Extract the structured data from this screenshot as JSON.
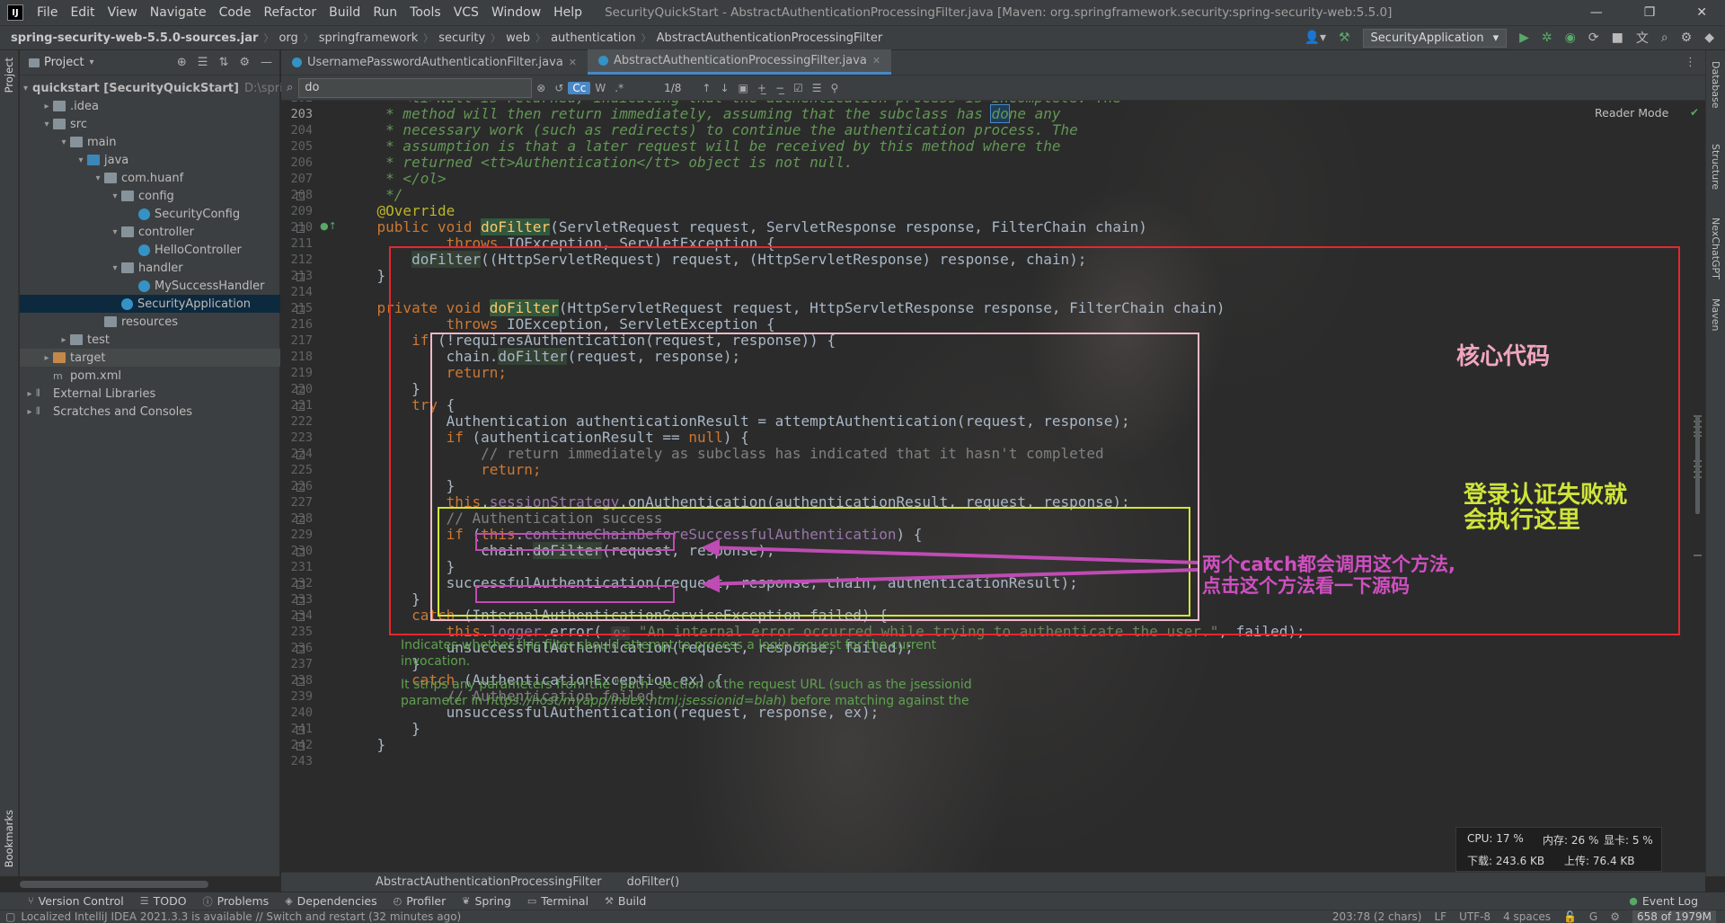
{
  "menubar": {
    "logo": "IJ",
    "items": [
      "File",
      "Edit",
      "View",
      "Navigate",
      "Code",
      "Refactor",
      "Build",
      "Run",
      "Tools",
      "VCS",
      "Window",
      "Help"
    ],
    "window_title": "SecurityQuickStart - AbstractAuthenticationProcessingFilter.java [Maven: org.springframework.security:spring-security-web:5.5.0]",
    "controls": [
      "—",
      "❐",
      "✕"
    ]
  },
  "navbar": {
    "crumbs": [
      "spring-security-web-5.5.0-sources.jar",
      "org",
      "springframework",
      "security",
      "web",
      "authentication",
      "AbstractAuthenticationProcessingFilter"
    ],
    "run_config": "SecurityApplication"
  },
  "left_stripe": {
    "project": "Project",
    "bookmarks": "Bookmarks"
  },
  "right_stripe": [
    "Database",
    "Structure",
    "NexChatGPT",
    "Maven"
  ],
  "project_panel": {
    "title": "Project",
    "tree": [
      {
        "label": "quickstart [SecurityQuickStart]",
        "extra": "D:\\spring",
        "depth": 0,
        "arrow": "▾",
        "icon": "folder"
      },
      {
        "label": ".idea",
        "depth": 1,
        "arrow": "▸",
        "icon": "folder"
      },
      {
        "label": "src",
        "depth": 1,
        "arrow": "▾",
        "icon": "folder"
      },
      {
        "label": "main",
        "depth": 2,
        "arrow": "▾",
        "icon": "folder"
      },
      {
        "label": "java",
        "depth": 3,
        "arrow": "▾",
        "icon": "folder-blue"
      },
      {
        "label": "com.huanf",
        "depth": 4,
        "arrow": "▾",
        "icon": "folder"
      },
      {
        "label": "config",
        "depth": 5,
        "arrow": "▾",
        "icon": "folder"
      },
      {
        "label": "SecurityConfig",
        "depth": 6,
        "arrow": "",
        "icon": "cls"
      },
      {
        "label": "controller",
        "depth": 5,
        "arrow": "▾",
        "icon": "folder"
      },
      {
        "label": "HelloController",
        "depth": 6,
        "arrow": "",
        "icon": "cls"
      },
      {
        "label": "handler",
        "depth": 5,
        "arrow": "▾",
        "icon": "folder"
      },
      {
        "label": "MySuccessHandler",
        "depth": 6,
        "arrow": "",
        "icon": "cls"
      },
      {
        "label": "SecurityApplication",
        "depth": 5,
        "arrow": "",
        "icon": "cls",
        "selected": true
      },
      {
        "label": "resources",
        "depth": 4,
        "arrow": "",
        "icon": "folder"
      },
      {
        "label": "test",
        "depth": 2,
        "arrow": "▸",
        "icon": "folder"
      },
      {
        "label": "target",
        "depth": 1,
        "arrow": "▸",
        "icon": "folder-orange",
        "hl": true
      },
      {
        "label": "pom.xml",
        "depth": 1,
        "arrow": "",
        "icon": "lib"
      },
      {
        "label": "External Libraries",
        "depth": 0,
        "arrow": "▸",
        "icon": "lib"
      },
      {
        "label": "Scratches and Consoles",
        "depth": 0,
        "arrow": "▸",
        "icon": "lib"
      }
    ]
  },
  "editor": {
    "tabs": [
      "UsernamePasswordAuthenticationFilter.java",
      "AbstractAuthenticationProcessingFilter.java"
    ],
    "find": {
      "query": "do",
      "count": "1/8",
      "match_case": "Cc",
      "words": "W",
      "regex": ".*"
    },
    "reader_mode": "Reader Mode",
    "line_numbers": [
      "202",
      "203",
      "204",
      "205",
      "206",
      "207",
      "208",
      "209",
      "210",
      "211",
      "212",
      "213",
      "214",
      "215",
      "216",
      "217",
      "218",
      "219",
      "220",
      "221",
      "222",
      "223",
      "224",
      "225",
      "226",
      "227",
      "228",
      "229",
      "230",
      "231",
      "232",
      "233",
      "234",
      "235",
      "236",
      "237",
      "238",
      "239",
      "240",
      "241",
      "242",
      "243"
    ],
    "current_line": "203"
  },
  "annotations": {
    "core_code": "核心代码",
    "fail_line1": "登录认证失败就",
    "fail_line2": "会执行这里",
    "catch_line1": "两个catch都会调用这个方法,",
    "catch_line2": "点击这个方法看一下源码",
    "colors": {
      "red": "#e8262d",
      "pink": "#f0b8c8",
      "yellow": "#d2e635",
      "magenta": "#c04bb4"
    }
  },
  "doc_popup": {
    "line1": "Indicates whether this filter should attempt to process a login request for the current",
    "line2": "invocation.",
    "line3": "It strips any parameters from the \"path\" section of the request URL (such as the jsessionid",
    "line4a": "parameter in ",
    "line4b": "https://host/myapp/index.html;jsessionid=blah",
    "line4c": ") before matching against the"
  },
  "sysmon": {
    "cpu": "CPU: 17 %",
    "mem": "内存: 26 %",
    "gpu": "显卡: 5 %",
    "down": "下载: 243.6 KB",
    "up": "上传: 76.4 KB"
  },
  "breadcrumb_bar": {
    "cls": "AbstractAuthenticationProcessingFilter",
    "method": "doFilter()"
  },
  "bottom_tools": [
    "Version Control",
    "TODO",
    "Problems",
    "Dependencies",
    "Profiler",
    "Spring",
    "Terminal",
    "Build"
  ],
  "event_log": "Event Log",
  "status": {
    "message": "Localized IntelliJ IDEA 2021.3.3 is available // Switch and restart (32 minutes ago)",
    "position": "203:78 (2 chars)",
    "lf": "LF",
    "encoding": "UTF-8",
    "indent": "4 spaces",
    "memory": "658 of 1979M"
  }
}
